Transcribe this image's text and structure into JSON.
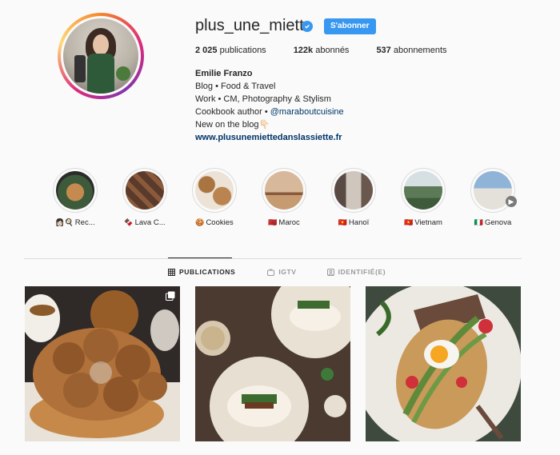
{
  "profile": {
    "username": "plus_une_miette",
    "follow_label": "S'abonner",
    "stats": [
      {
        "count": "2 025",
        "label": " publications"
      },
      {
        "count": "122k",
        "label": " abonnés"
      },
      {
        "count": "537",
        "label": " abonnements"
      }
    ],
    "bio": {
      "name": "Emilie Franzo",
      "line1": "Blog • Food & Travel",
      "line2": "Work • CM, Photography & Stylism",
      "line3_prefix": "Cookbook author • ",
      "line3_mention": "@maraboutcuisine",
      "line4": "New on the blog👇🏻",
      "website": "www.plusunemiettedanslassiette.fr"
    }
  },
  "highlights": [
    {
      "emoji": "👩🏻🍳",
      "label": "Rec..."
    },
    {
      "emoji": "🍫",
      "label": "Lava C..."
    },
    {
      "emoji": "🍪",
      "label": "Cookies"
    },
    {
      "emoji": "🇲🇦",
      "label": "Maroc"
    },
    {
      "emoji": "🇻🇳",
      "label": "Hanoï"
    },
    {
      "emoji": "🇻🇳",
      "label": "Vietnam"
    },
    {
      "emoji": "🇮🇹",
      "label": "Genova"
    }
  ],
  "tabs": {
    "publications": "PUBLICATIONS",
    "igtv": "IGTV",
    "tagged": "IDENTIFIÉ(E)"
  },
  "colors": {
    "accent": "#3897f0",
    "text": "#262626",
    "link": "#003569",
    "background": "#fafafa"
  }
}
